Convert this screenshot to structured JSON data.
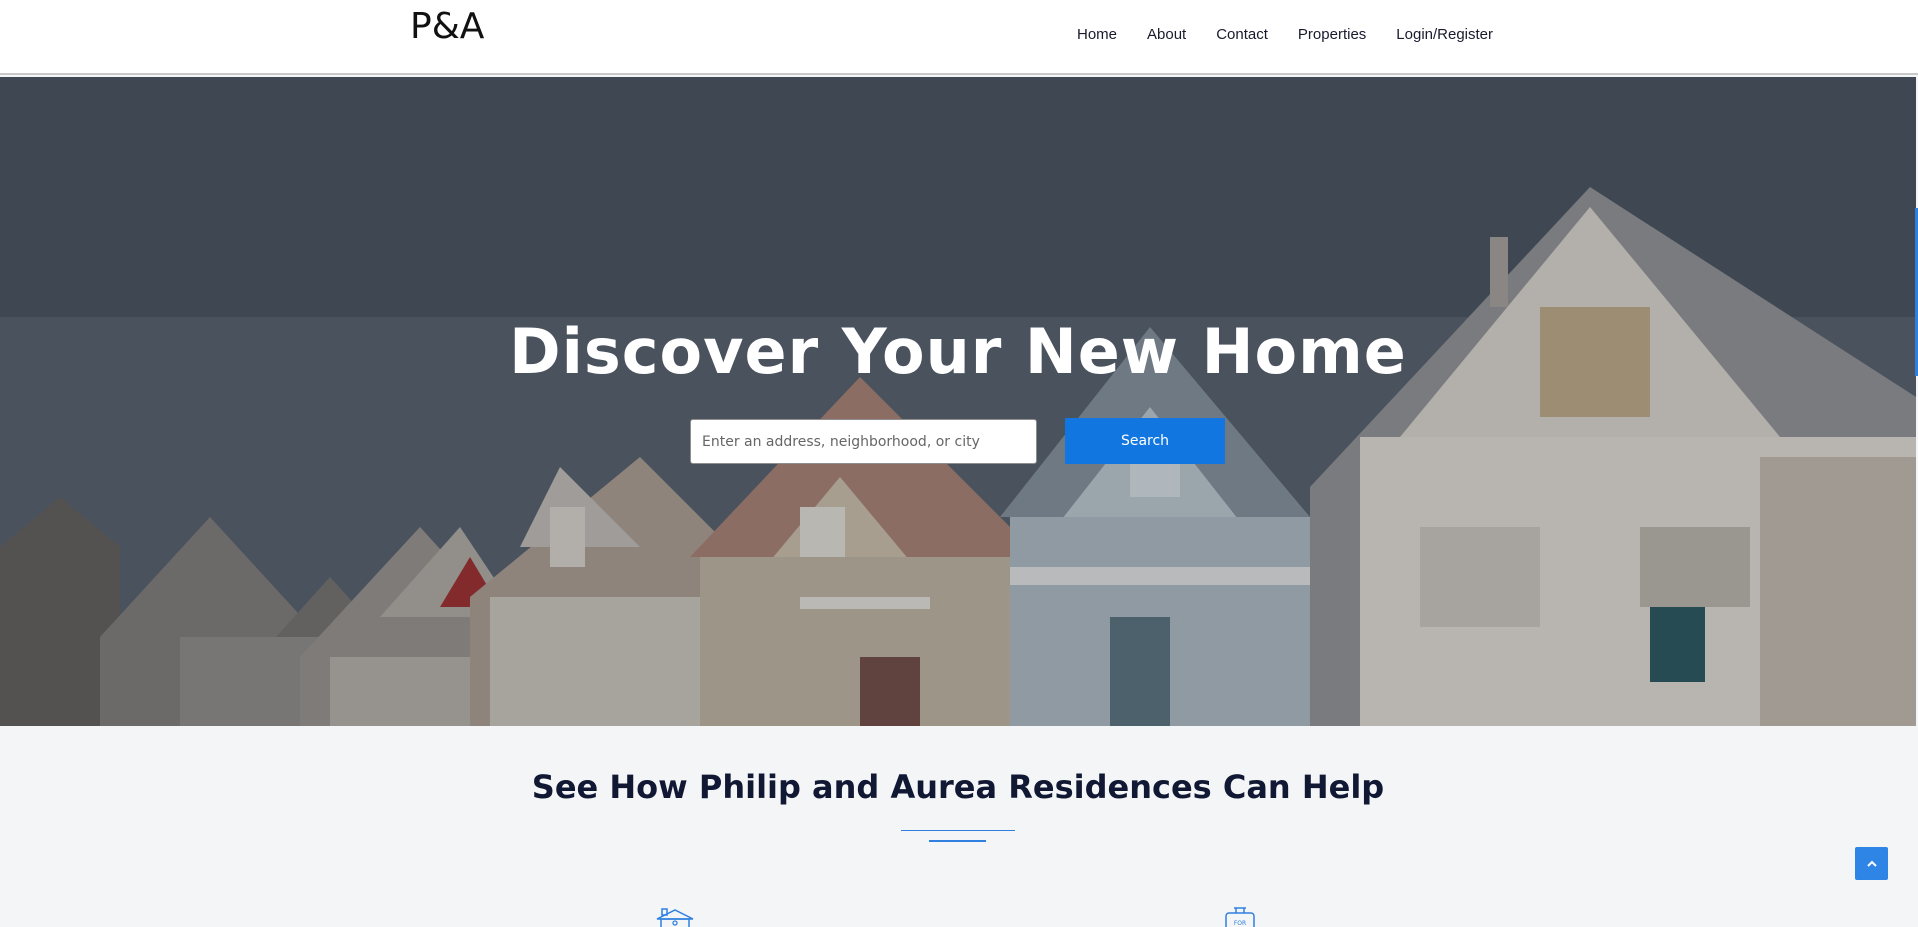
{
  "brand": {
    "logo_text": "P&A"
  },
  "nav": {
    "items": [
      {
        "label": "Home"
      },
      {
        "label": "About"
      },
      {
        "label": "Contact"
      },
      {
        "label": "Properties"
      },
      {
        "label": "Login/Register"
      }
    ]
  },
  "hero": {
    "title": "Discover Your New Home",
    "search_placeholder": "Enter an address, neighborhood, or city",
    "search_button": "Search"
  },
  "help_section": {
    "title": "See How Philip and Aurea Residences Can Help",
    "icons": [
      "house-icon",
      "for-sale-sign-icon"
    ]
  },
  "colors": {
    "accent": "#1176e0",
    "nav_bg": "#ffffff",
    "section_bg": "#f4f5f7",
    "heading": "#111833"
  },
  "back_to_top": {
    "icon": "chevron-up-icon"
  }
}
